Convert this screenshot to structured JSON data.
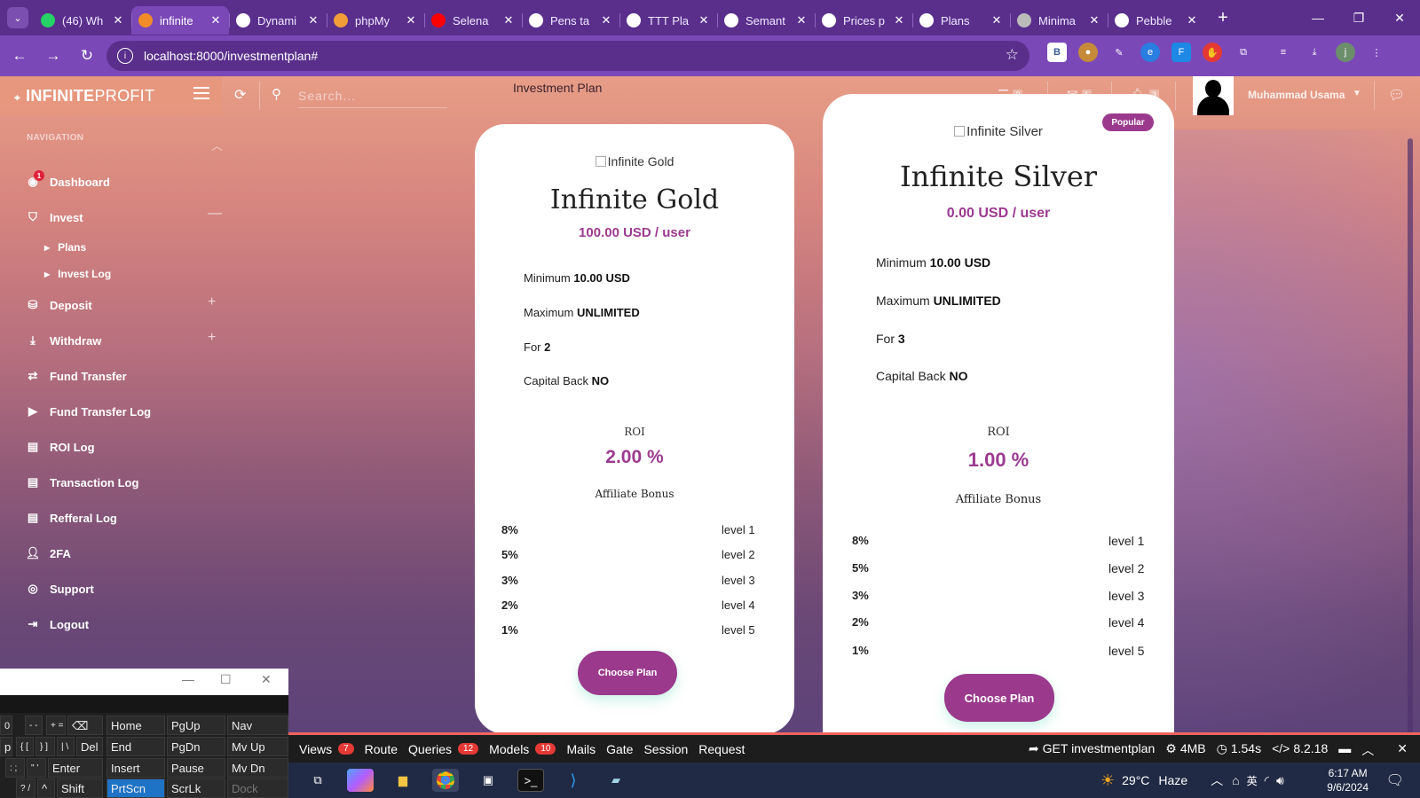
{
  "browser": {
    "tabs": [
      {
        "title": "(46) Wh",
        "icon": "whatsapp-icon",
        "active": false
      },
      {
        "title": "infinite",
        "icon": "site-logo-icon",
        "active": true
      },
      {
        "title": "Dynami",
        "icon": "openai-icon",
        "active": false
      },
      {
        "title": "phpMy",
        "icon": "phpmyadmin-icon",
        "active": false
      },
      {
        "title": "Selena",
        "icon": "youtube-icon",
        "active": false
      },
      {
        "title": "Pens ta",
        "icon": "codepen-icon",
        "active": false
      },
      {
        "title": "TTT Pla",
        "icon": "codepen-icon",
        "active": false
      },
      {
        "title": "Semant",
        "icon": "openai-icon",
        "active": false
      },
      {
        "title": "Prices p",
        "icon": "codepen-icon",
        "active": false
      },
      {
        "title": "Plans",
        "icon": "codepen-icon",
        "active": false
      },
      {
        "title": "Minima",
        "icon": "gear-icon",
        "active": false
      },
      {
        "title": "Pebble",
        "icon": "cloud-icon",
        "active": false
      }
    ],
    "url": "localhost:8000/investmentplan#"
  },
  "app": {
    "brand_bold": "INFINITE",
    "brand_light": "PROFIT",
    "search_placeholder": "Search...",
    "page_title": "Investment Plan",
    "topbar_counts": {
      "tasks": "2",
      "mail": "1",
      "alerts": "3"
    },
    "user_name": "Muhammad Usama"
  },
  "sidebar": {
    "heading": "NAVIGATION",
    "dashboard_badge": "1",
    "items": [
      {
        "label": "Dashboard",
        "icon": "palette-icon"
      },
      {
        "label": "Invest",
        "icon": "tag-icon"
      },
      {
        "label": "Deposit",
        "icon": "coins-icon"
      },
      {
        "label": "Withdraw",
        "icon": "withdraw-icon"
      },
      {
        "label": "Fund Transfer",
        "icon": "exchange-icon"
      },
      {
        "label": "Fund Transfer Log",
        "icon": "play-circle-icon"
      },
      {
        "label": "ROI Log",
        "icon": "file-icon"
      },
      {
        "label": "Transaction Log",
        "icon": "file-icon"
      },
      {
        "label": "Refferal Log",
        "icon": "file-icon"
      },
      {
        "label": "2FA",
        "icon": "user-lock-icon"
      },
      {
        "label": "Support",
        "icon": "support-icon"
      },
      {
        "label": "Logout",
        "icon": "logout-icon"
      }
    ],
    "invest_sub": [
      "Plans",
      "Invest Log"
    ]
  },
  "plans": [
    {
      "image_alt": "Infinite Gold",
      "name": "Infinite Gold",
      "price": "100.00 USD / user",
      "minimum_label": "Minimum",
      "minimum_value": "10.00 USD",
      "maximum_label": "Maximum",
      "maximum_value": "UNLIMITED",
      "for_label": "For",
      "for_value": "2",
      "capital_label": "Capital Back",
      "capital_value": "NO",
      "roi_label": "ROI",
      "roi_value": "2.00 %",
      "affiliate_label": "Affiliate Bonus",
      "levels": [
        {
          "pct": "8%",
          "level": "level 1"
        },
        {
          "pct": "5%",
          "level": "level 2"
        },
        {
          "pct": "3%",
          "level": "level 3"
        },
        {
          "pct": "2%",
          "level": "level 4"
        },
        {
          "pct": "1%",
          "level": "level 5"
        }
      ],
      "button": "Choose Plan"
    },
    {
      "image_alt": "Infinite Silver",
      "badge": "Popular",
      "name": "Infinite Silver",
      "price": "0.00 USD / user",
      "minimum_label": "Minimum",
      "minimum_value": "10.00 USD",
      "maximum_label": "Maximum",
      "maximum_value": "UNLIMITED",
      "for_label": "For",
      "for_value": "3",
      "capital_label": "Capital Back",
      "capital_value": "NO",
      "roi_label": "ROI",
      "roi_value": "1.00 %",
      "affiliate_label": "Affiliate Bonus",
      "levels": [
        {
          "pct": "8%",
          "level": "level 1"
        },
        {
          "pct": "5%",
          "level": "level 2"
        },
        {
          "pct": "3%",
          "level": "level 3"
        },
        {
          "pct": "2%",
          "level": "level 4"
        },
        {
          "pct": "1%",
          "level": "level 5"
        }
      ],
      "button": "Choose Plan"
    }
  ],
  "keyboard": {
    "keys": {
      "k0": "0",
      "k_minus": "- -",
      "k_eq": "+ =",
      "k_bksp": "⌫",
      "home": "Home",
      "pgup": "PgUp",
      "nav": "Nav",
      "p": "p",
      "brk": "{ [",
      "brk2": "} ]",
      "bsl": "| \\",
      "del": "Del",
      "end": "End",
      "pgdn": "PgDn",
      "mvup": "Mv Up",
      "semi": ": ;",
      "quote": "\" '",
      "enter": "Enter",
      "insert": "Insert",
      "pause": "Pause",
      "mvdn": "Mv Dn",
      "slash": "? /",
      "up": "^",
      "shift": "Shift",
      "prtscn": "PrtScn",
      "scrlk": "ScrLk",
      "dock": "Dock"
    }
  },
  "debugbar": {
    "items": [
      {
        "label": "Views",
        "count": "7"
      },
      {
        "label": "Route"
      },
      {
        "label": "Queries",
        "count": "12"
      },
      {
        "label": "Models",
        "count": "10"
      },
      {
        "label": "Mails"
      },
      {
        "label": "Gate"
      },
      {
        "label": "Session"
      },
      {
        "label": "Request"
      }
    ],
    "request": "GET investmentplan",
    "memory": "4MB",
    "time": "1.54s",
    "php": "8.2.18"
  },
  "taskbar": {
    "weather_temp": "29°C",
    "weather_desc": "Haze",
    "time": "6:17 AM",
    "date": "9/6/2024"
  },
  "colors": {
    "accent": "#9b3a8d",
    "tabstrip": "#5a2f8c",
    "debug_red": "#f4645f"
  }
}
